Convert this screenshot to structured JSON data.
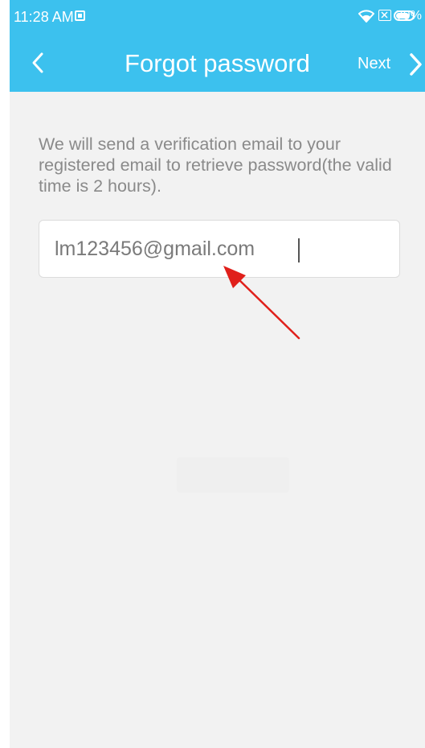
{
  "status_bar": {
    "time": "11:28 AM",
    "battery_percent": "79%",
    "battery_level": 0.79,
    "icons": [
      "notification-icon",
      "wifi-icon",
      "no-sim-icon",
      "battery-icon"
    ]
  },
  "header": {
    "title": "Forgot password",
    "back_icon": "chevron-left-icon",
    "next_label": "Next",
    "next_icon": "chevron-right-icon"
  },
  "content": {
    "description": "We will send a verification email to your registered email to retrieve password(the valid time is 2 hours).",
    "email_value": "lm123456@gmail.com"
  },
  "annotation": {
    "icon": "red-arrow-annotation",
    "color": "#e0201b"
  },
  "colors": {
    "header": "#3cc1ee",
    "background": "#f2f2f2"
  }
}
